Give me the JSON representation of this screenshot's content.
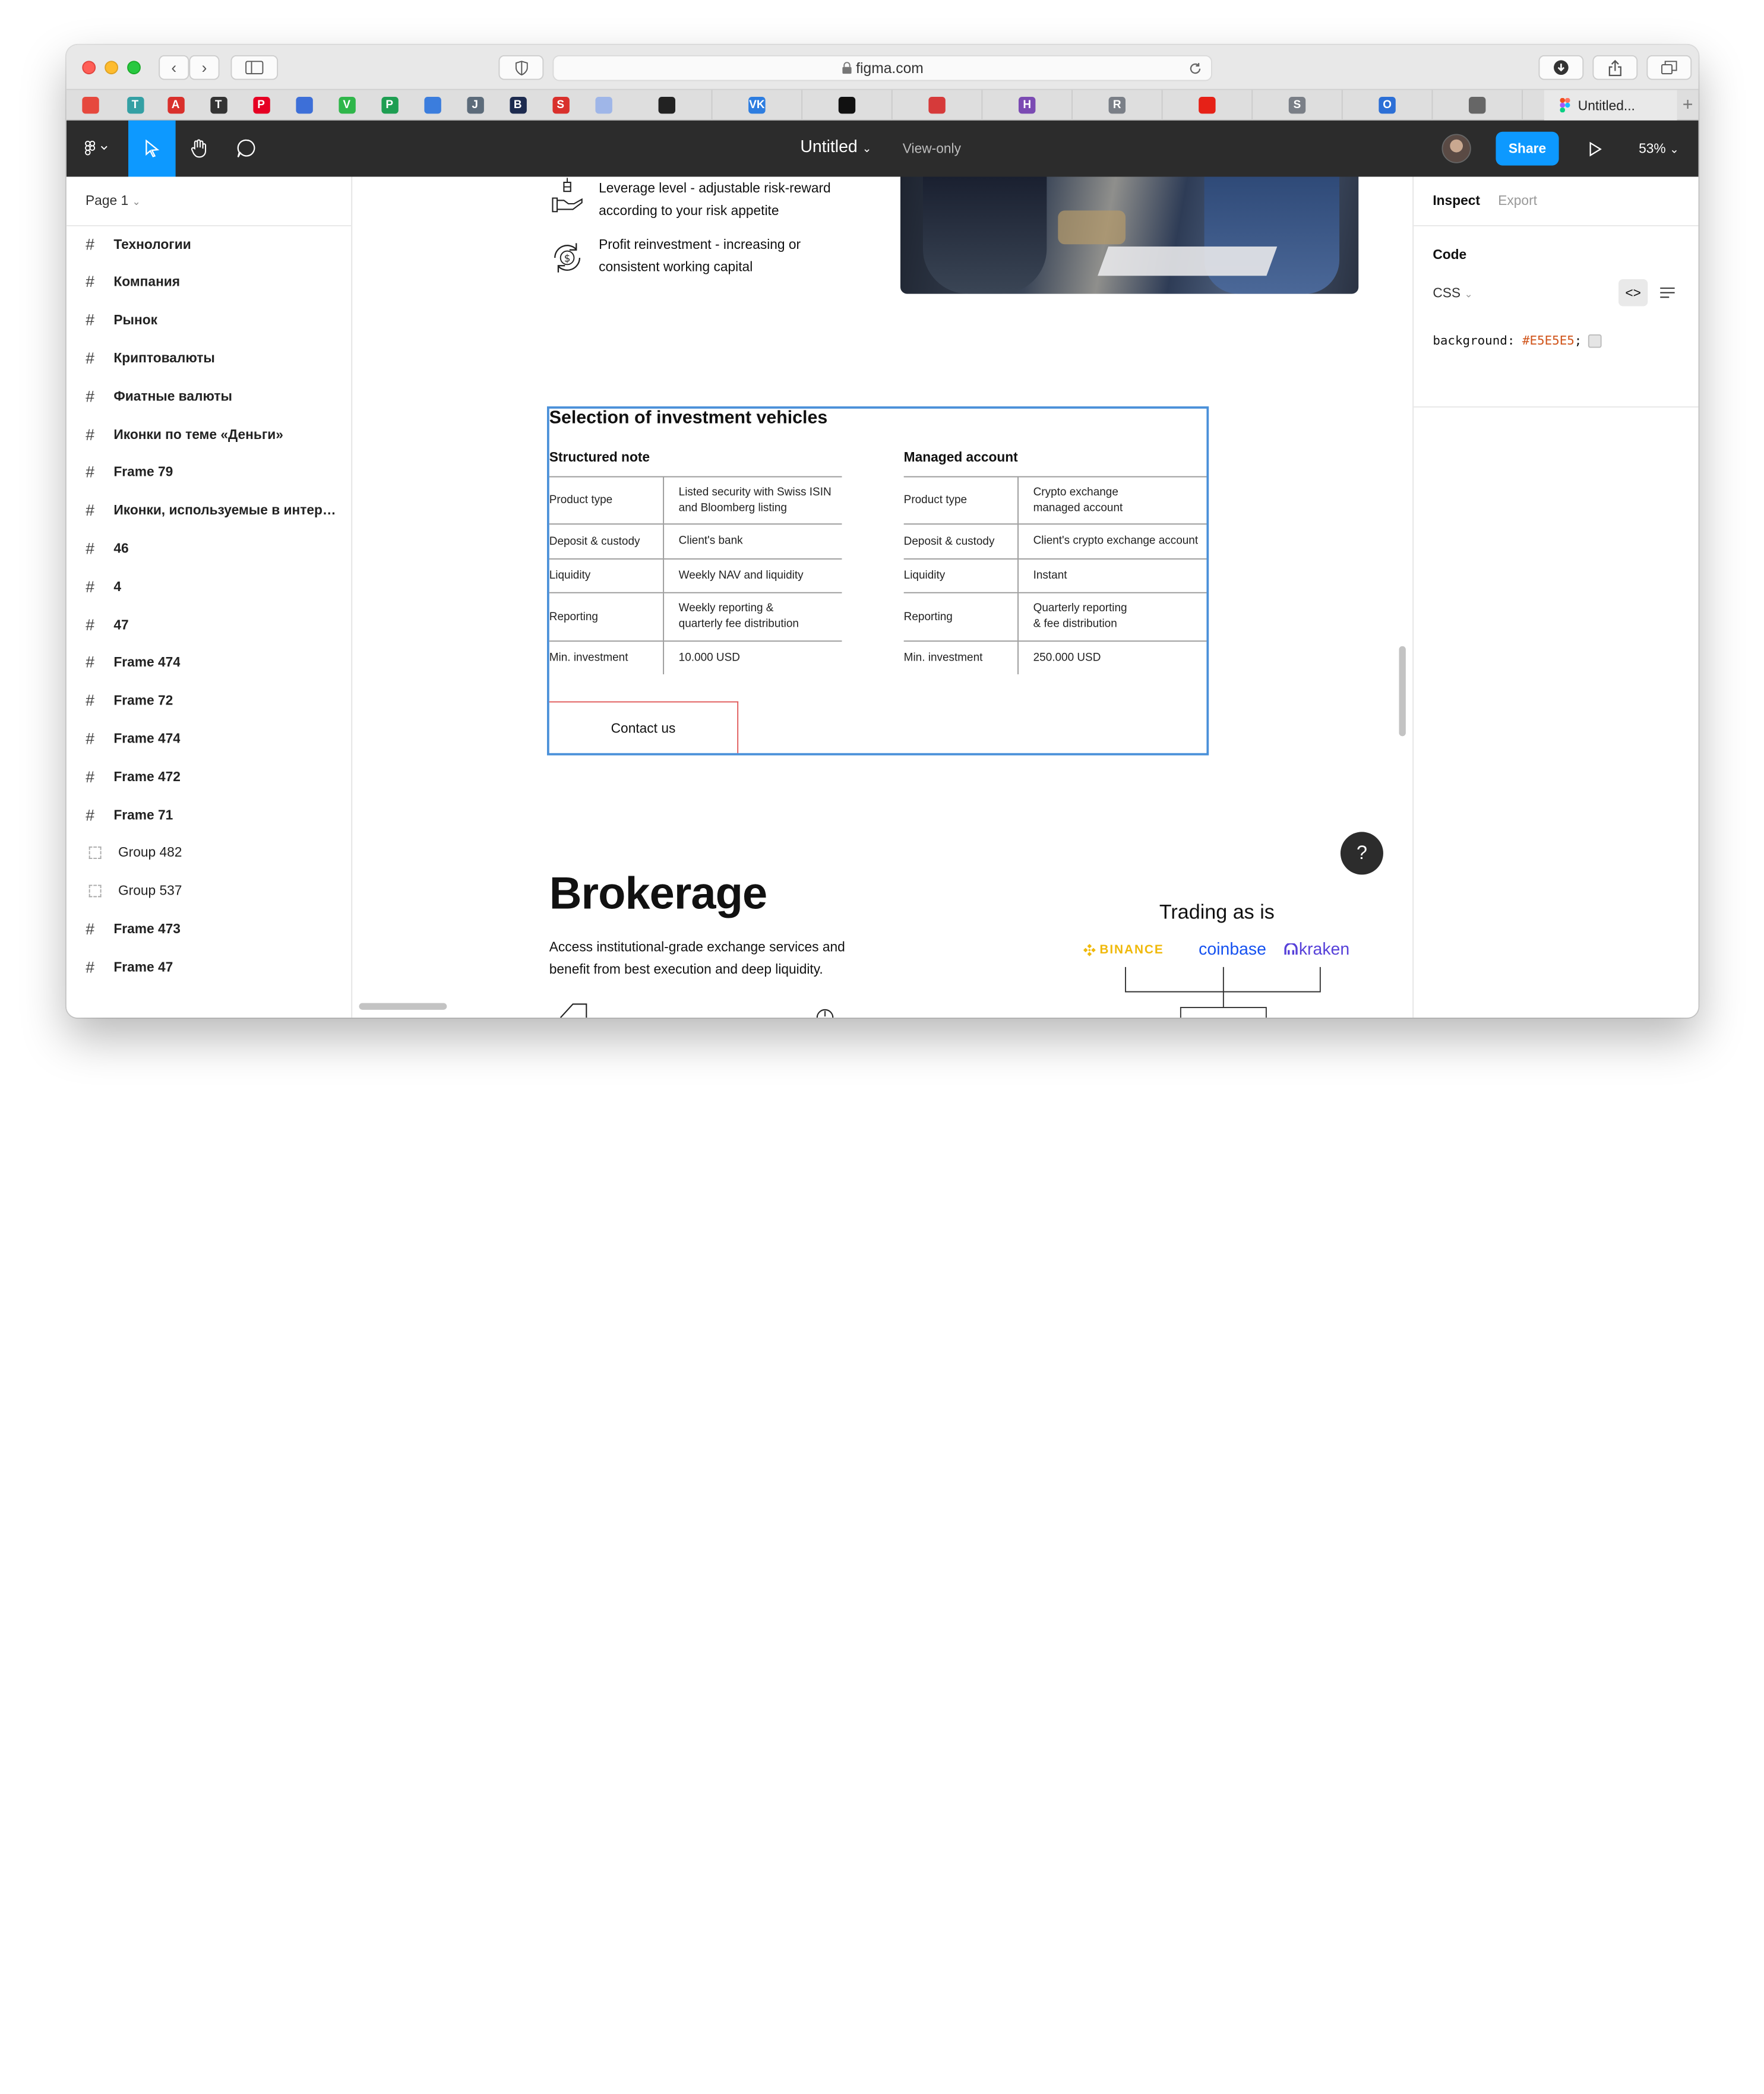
{
  "browser": {
    "url": "figma.com",
    "active_tab_title": "Untitled...",
    "favorites": [
      {
        "icon": "chrome-multicolor-icon",
        "letter": "",
        "color": "#e6483d"
      },
      {
        "icon": "t-icon",
        "letter": "T",
        "color": "#34a0a4"
      },
      {
        "icon": "a-red-icon",
        "letter": "A",
        "color": "#d9302c"
      },
      {
        "icon": "circle-t-icon",
        "letter": "T",
        "color": "#333333"
      },
      {
        "icon": "pinterest-icon",
        "letter": "P",
        "color": "#e60023"
      },
      {
        "icon": "reddit-robot-icon",
        "letter": "",
        "color": "#3d6fd8"
      },
      {
        "icon": "v-green-icon",
        "letter": "V",
        "color": "#2fb64a"
      },
      {
        "icon": "p-green-icon",
        "letter": "P",
        "color": "#1e9e52"
      },
      {
        "icon": "blue-square-icon",
        "letter": "",
        "color": "#3b7ddd"
      },
      {
        "icon": "j-icon",
        "letter": "J",
        "color": "#5c6b7a"
      },
      {
        "icon": "b-icon",
        "letter": "B",
        "color": "#1d2b4f"
      },
      {
        "icon": "s-red-icon",
        "letter": "S",
        "color": "#d9302c"
      },
      {
        "icon": "play-circle-icon",
        "letter": "",
        "color": "#9fb6e8"
      }
    ],
    "favorites_wide": [
      {
        "icon": "instagram-icon",
        "letter": "",
        "color": "#222222"
      },
      {
        "icon": "vk-icon",
        "letter": "VK",
        "color": "#2d7de0"
      },
      {
        "icon": "github-icon",
        "letter": "",
        "color": "#111111"
      },
      {
        "icon": "asterisk-red-icon",
        "letter": "",
        "color": "#d63a3a"
      },
      {
        "icon": "h-purple-icon",
        "letter": "H",
        "color": "#7b4bb3"
      },
      {
        "icon": "r-gray-icon",
        "letter": "R",
        "color": "#7a7f87"
      },
      {
        "icon": "youtube-icon",
        "letter": "",
        "color": "#e62117"
      },
      {
        "icon": "s-gray-icon",
        "letter": "S",
        "color": "#7a7f87"
      },
      {
        "icon": "o-blue-icon",
        "letter": "O",
        "color": "#2c6fd6"
      },
      {
        "icon": "compass-icon",
        "letter": "",
        "color": "#666666"
      }
    ]
  },
  "figma": {
    "file_title": "Untitled",
    "mode": "View-only",
    "share_label": "Share",
    "zoom": "53%"
  },
  "left_panel": {
    "page": "Page 1",
    "layers": [
      {
        "label": "Технологии",
        "type": "frame"
      },
      {
        "label": "Компания",
        "type": "frame"
      },
      {
        "label": "Рынок",
        "type": "frame"
      },
      {
        "label": "Криптовалюты",
        "type": "frame"
      },
      {
        "label": "Фиатные валюты",
        "type": "frame"
      },
      {
        "label": "Иконки по теме «Деньги»",
        "type": "frame"
      },
      {
        "label": "Frame 79",
        "type": "frame"
      },
      {
        "label": "Иконки, используемые в интерф...",
        "type": "frame"
      },
      {
        "label": "46",
        "type": "frame"
      },
      {
        "label": "4",
        "type": "frame"
      },
      {
        "label": "47",
        "type": "frame"
      },
      {
        "label": "Frame 474",
        "type": "frame"
      },
      {
        "label": "Frame 72",
        "type": "frame"
      },
      {
        "label": "Frame 474",
        "type": "frame"
      },
      {
        "label": "Frame 472",
        "type": "frame"
      },
      {
        "label": "Frame 71",
        "type": "frame"
      },
      {
        "label": "Group 482",
        "type": "group"
      },
      {
        "label": "Group 537",
        "type": "group"
      },
      {
        "label": "Frame 473",
        "type": "frame"
      },
      {
        "label": "Frame 47",
        "type": "frame"
      }
    ]
  },
  "canvas": {
    "features": [
      {
        "line1": "Leverage level - adjustable risk-reward",
        "line2": "according to your risk appetite"
      },
      {
        "line1": "Profit reinvestment - increasing or",
        "line2": "consistent working capital"
      }
    ],
    "selection_title": "Selection of investment vehicles",
    "tables": [
      {
        "heading": "Structured note",
        "rows": [
          {
            "label": "Product type",
            "value1": "Listed security with Swiss ISIN",
            "value2": "and Bloomberg listing"
          },
          {
            "label": "Deposit & custody",
            "value1": "Client's bank",
            "value2": ""
          },
          {
            "label": "Liquidity",
            "value1": "Weekly NAV and liquidity",
            "value2": ""
          },
          {
            "label": "Reporting",
            "value1": "Weekly reporting &",
            "value2": "quarterly fee distribution"
          },
          {
            "label": "Min. investment",
            "value1": "10.000 USD",
            "value2": ""
          }
        ]
      },
      {
        "heading": "Managed account",
        "rows": [
          {
            "label": "Product type",
            "value1": "Crypto exchange",
            "value2": "managed account"
          },
          {
            "label": "Deposit & custody",
            "value1": "Client's crypto exchange account",
            "value2": ""
          },
          {
            "label": "Liquidity",
            "value1": "Instant",
            "value2": ""
          },
          {
            "label": "Reporting",
            "value1": "Quarterly reporting",
            "value2": "& fee distribution"
          },
          {
            "label": "Min. investment",
            "value1": "250.000 USD",
            "value2": ""
          }
        ]
      }
    ],
    "contact_label": "Contact us",
    "brokerage_title": "Brokerage",
    "brokerage_desc_1": "Access institutional-grade exchange services and",
    "brokerage_desc_2": "benefit from best execution and deep liquidity.",
    "trading_title": "Trading as is",
    "exchanges": {
      "binance": "BINANCE",
      "coinbase": "coinbase",
      "kraken": "kraken"
    },
    "binance_color": "#f0b90b",
    "coinbase_color": "#1652f0",
    "kraken_color": "#5741d9"
  },
  "right_panel": {
    "tab_inspect": "Inspect",
    "tab_export": "Export",
    "code_label": "Code",
    "lang": "CSS",
    "code_prop": "background:",
    "code_value": "#E5E5E5",
    "code_end": ";"
  },
  "help_label": "?"
}
